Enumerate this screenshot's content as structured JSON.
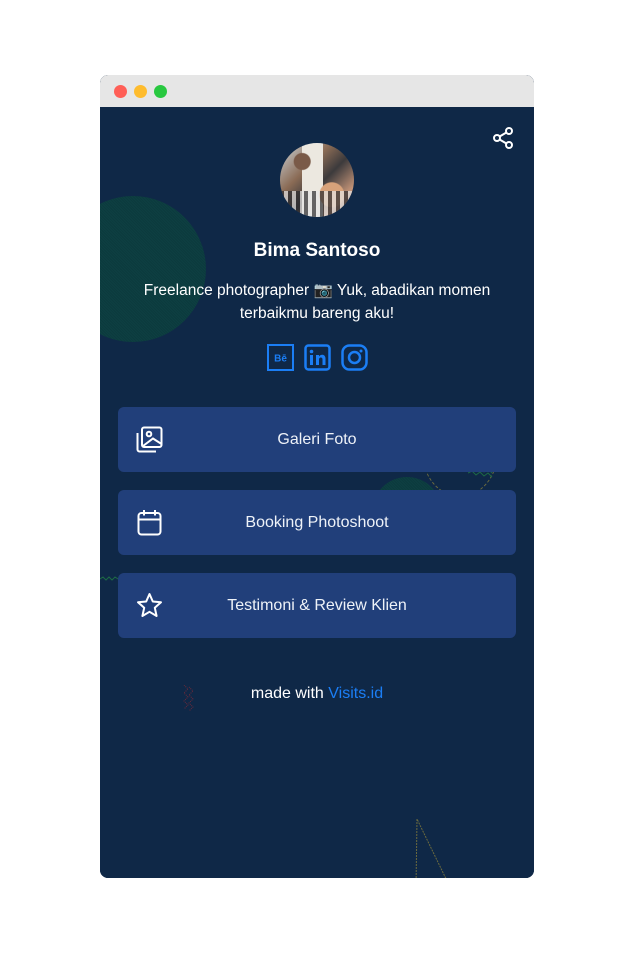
{
  "window": {
    "controls": [
      "close",
      "minimize",
      "maximize"
    ]
  },
  "profile": {
    "name": "Bima Santoso",
    "bio": "Freelance photographer 📷 Yuk, abadikan momen terbaikmu bareng aku!",
    "avatar": "profile-photo"
  },
  "share": {
    "icon": "share-icon"
  },
  "socials": [
    {
      "name": "behance",
      "icon": "behance-icon",
      "glyph": "Bē"
    },
    {
      "name": "linkedin",
      "icon": "linkedin-icon",
      "glyph": "in"
    },
    {
      "name": "instagram",
      "icon": "instagram-icon"
    }
  ],
  "links": [
    {
      "label": "Galeri Foto",
      "icon": "gallery-icon"
    },
    {
      "label": "Booking Photoshoot",
      "icon": "calendar-icon"
    },
    {
      "label": "Testimoni & Review Klien",
      "icon": "star-icon"
    }
  ],
  "footer": {
    "prefix": "made with",
    "brand": "Visits.id"
  },
  "colors": {
    "background": "#0f2847",
    "button": "#213f7a",
    "accent": "#1b7ef5",
    "text": "#ffffff"
  }
}
